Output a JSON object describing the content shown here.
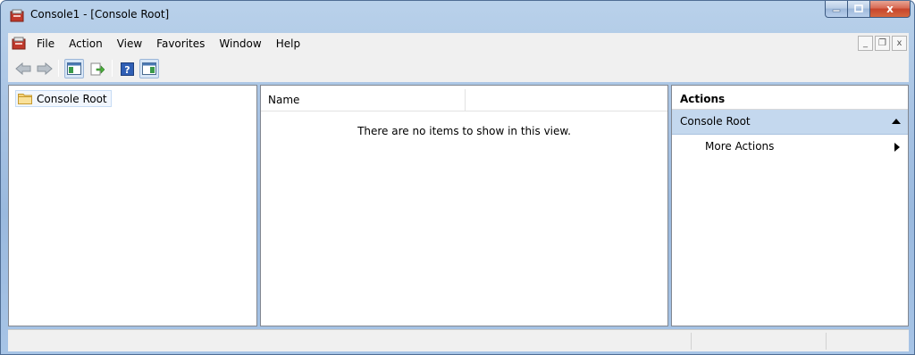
{
  "window": {
    "title": "Console1 - [Console Root]",
    "app_icon": "mmc-console-icon",
    "caption_buttons": [
      "minimize",
      "maximize",
      "close"
    ],
    "close_glyph": "x"
  },
  "menubar": {
    "items": [
      "File",
      "Action",
      "View",
      "Favorites",
      "Window",
      "Help"
    ],
    "mdi_buttons": {
      "minimize": "_",
      "restore": "❐",
      "close": "x"
    }
  },
  "toolbar": {
    "buttons": [
      "back-arrow-icon",
      "forward-arrow-icon",
      "show-hide-console-tree-icon",
      "export-list-icon",
      "help-icon",
      "show-hide-action-pane-icon"
    ]
  },
  "tree": {
    "root_label": "Console Root"
  },
  "list": {
    "column_name": "Name",
    "empty_message": "There are no items to show in this view."
  },
  "actions": {
    "title": "Actions",
    "section_label": "Console Root",
    "more_actions_label": "More Actions"
  },
  "colors": {
    "frame": "#a9c4e4",
    "section_highlight": "#c4d8ee",
    "close_button": "#c7452c"
  }
}
